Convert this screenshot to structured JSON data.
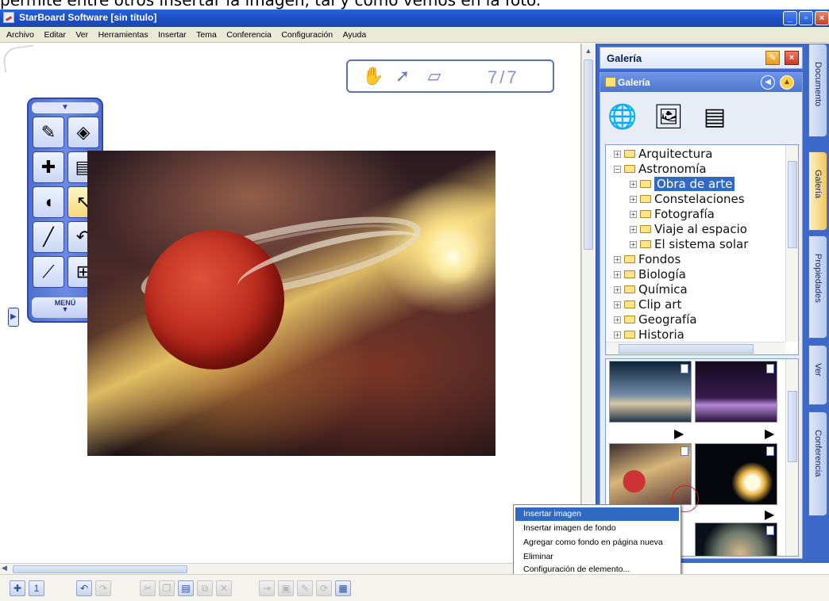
{
  "caption": "permite entre otros insertar la imagen, tal y como vemos en la foto.",
  "window": {
    "title": "StarBoard Software [sin título]"
  },
  "menu": [
    "Archivo",
    "Editar",
    "Ver",
    "Herramientas",
    "Insertar",
    "Tema",
    "Conferencia",
    "Configuración",
    "Ayuda"
  ],
  "page_nav": {
    "counter": "7/7"
  },
  "toolbox": {
    "menu_label": "MENÚ"
  },
  "panel": {
    "title": "Galería",
    "gallery_header": "Galería",
    "tree": [
      {
        "label": "Arquitectura",
        "level": 0,
        "expand": "+"
      },
      {
        "label": "Astronomía",
        "level": 0,
        "expand": "−"
      },
      {
        "label": "Obra de arte",
        "level": 1,
        "expand": "+",
        "selected": true
      },
      {
        "label": "Constelaciones",
        "level": 1,
        "expand": "+"
      },
      {
        "label": "Fotografía",
        "level": 1,
        "expand": "+"
      },
      {
        "label": "Viaje al espacio",
        "level": 1,
        "expand": "+"
      },
      {
        "label": "El sistema solar",
        "level": 1,
        "expand": "+"
      },
      {
        "label": "Fondos",
        "level": 0,
        "expand": "+"
      },
      {
        "label": "Biología",
        "level": 0,
        "expand": "+"
      },
      {
        "label": "Química",
        "level": 0,
        "expand": "+"
      },
      {
        "label": "Clip art",
        "level": 0,
        "expand": "+"
      },
      {
        "label": "Geografía",
        "level": 0,
        "expand": "+"
      },
      {
        "label": "Historia",
        "level": 0,
        "expand": "+"
      }
    ]
  },
  "side_tabs": [
    "Documento",
    "Galería",
    "Propiedades",
    "Ver",
    "Conferencia"
  ],
  "context_menu": [
    "Insertar imagen",
    "Insertar imagen de fondo",
    "Agregar como fondo en página nueva",
    "Eliminar",
    "Configuración de elemento..."
  ],
  "colors": {
    "accent": "#316ac5",
    "dock": "#3c68c9",
    "title_bar": "#1b4fc2"
  }
}
